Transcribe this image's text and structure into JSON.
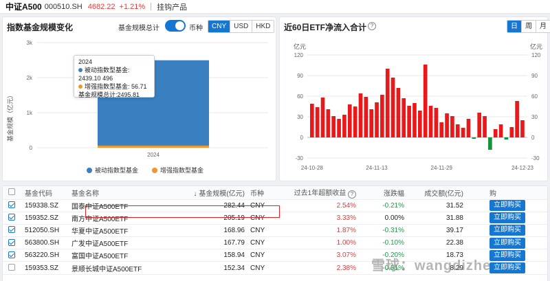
{
  "header": {
    "name": "中证A500",
    "code": "000510.SH",
    "price": "4682.22",
    "change": "+1.21%",
    "tag": "挂钩产品"
  },
  "scale_panel": {
    "title": "指数基金规模变化",
    "toggle_label": "基金规模总计",
    "currency_label": "币种",
    "currencies": [
      "CNY",
      "USD",
      "HKD"
    ],
    "active_currency": "CNY",
    "y_axis_label": "基金规模（亿元）",
    "tooltip": {
      "year": "2024",
      "passive_label": "被动指数型基金:",
      "passive_value": "2439.10",
      "enhanced_label": "增强指数型基金:",
      "enhanced_value": "56.71",
      "total_label": "基金规模总计:",
      "total_value": "2495.81",
      "stray": "496"
    },
    "legend": {
      "passive": "被动指数型基金",
      "enhanced": "增强指数型基金"
    },
    "colors": {
      "passive": "#3a7fbf",
      "enhanced": "#f0962b"
    }
  },
  "flow_panel": {
    "title": "近60日ETF净流入合计",
    "periods": [
      "日",
      "周",
      "月"
    ],
    "active_period": "日",
    "unit_left": "亿元",
    "unit_right": "亿元",
    "colors": {
      "positive": "#e8191b",
      "negative": "#14943b"
    }
  },
  "chart_data": [
    {
      "type": "bar",
      "categories": [
        "2024"
      ],
      "series": [
        {
          "name": "被动指数型基金",
          "values": [
            2439.1
          ]
        },
        {
          "name": "增强指数型基金",
          "values": [
            56.71
          ]
        }
      ],
      "yticks": [
        "3k",
        "2k",
        "1k",
        "0"
      ],
      "ylim": [
        0,
        3000
      ],
      "ylabel": "基金规模（亿元）",
      "legend": "bottom"
    },
    {
      "type": "bar",
      "title": "近60日ETF净流入合计",
      "x": [
        "24-10-28",
        "24-10-29",
        "24-10-30",
        "24-10-31",
        "24-11-01",
        "24-11-04",
        "24-11-05",
        "24-11-06",
        "24-11-07",
        "24-11-08",
        "24-11-11",
        "24-11-12",
        "24-11-13",
        "24-11-14",
        "24-11-15",
        "24-11-18",
        "24-11-19",
        "24-11-20",
        "24-11-21",
        "24-11-22",
        "24-11-25",
        "24-11-26",
        "24-11-27",
        "24-11-28",
        "24-11-29",
        "24-12-02",
        "24-12-03",
        "24-12-04",
        "24-12-05",
        "24-12-06",
        "24-12-09",
        "24-12-10",
        "24-12-11",
        "24-12-12",
        "24-12-13",
        "24-12-16",
        "24-12-17",
        "24-12-18",
        "24-12-19",
        "24-12-20",
        "24-12-23"
      ],
      "values": [
        49,
        44,
        58,
        41,
        31,
        27,
        33,
        48,
        45,
        64,
        59,
        41,
        51,
        62,
        100,
        87,
        72,
        57,
        46,
        50,
        39,
        106,
        46,
        43,
        22,
        35,
        31,
        19,
        14,
        27,
        -2,
        36,
        31,
        -18,
        12,
        19,
        -3,
        15,
        53,
        25
      ],
      "xticks": [
        "24-10-28",
        "24-11-13",
        "24-11-29",
        "24-12-23"
      ],
      "yticks": [
        120,
        90,
        60,
        30,
        0,
        -30
      ],
      "ylim": [
        -30,
        120
      ],
      "ylabel": "亿元"
    }
  ],
  "table": {
    "headers": [
      "基金代码",
      "基金名称",
      "基金规模(亿元)",
      "币种",
      "过去1年超额收益",
      "涨跌幅",
      "成交额(亿元)",
      "购"
    ],
    "sort_arrow": "↓",
    "buy_label": "立即购买",
    "rows": [
      {
        "checked": true,
        "code": "159338.SZ",
        "name": "国泰中证A500ETF",
        "scale": "282.44",
        "currency": "CNY",
        "excess": "2.54%",
        "change": "-0.21%",
        "turnover": "31.52"
      },
      {
        "checked": true,
        "code": "159352.SZ",
        "name": "南方中证A500ETF",
        "scale": "205.19",
        "currency": "CNY",
        "excess": "3.33%",
        "change": "0.00%",
        "turnover": "31.88"
      },
      {
        "checked": true,
        "code": "512050.SH",
        "name": "华夏中证A500ETF",
        "scale": "168.96",
        "currency": "CNY",
        "excess": "1.87%",
        "change": "-0.31%",
        "turnover": "39.17"
      },
      {
        "checked": true,
        "code": "563800.SH",
        "name": "广发中证A500ETF",
        "scale": "167.79",
        "currency": "CNY",
        "excess": "1.00%",
        "change": "-0.10%",
        "turnover": "22.38"
      },
      {
        "checked": true,
        "code": "563220.SH",
        "name": "富国中证A500ETF",
        "scale": "158.94",
        "currency": "CNY",
        "excess": "3.07%",
        "change": "-0.20%",
        "turnover": "18.73"
      },
      {
        "checked": false,
        "code": "159353.SZ",
        "name": "景顺长城中证A500ETF",
        "scale": "152.34",
        "currency": "CNY",
        "excess": "2.38%",
        "change": "-0.51%",
        "turnover": "8.29"
      }
    ]
  },
  "watermark": "雪球：wangdizhe"
}
